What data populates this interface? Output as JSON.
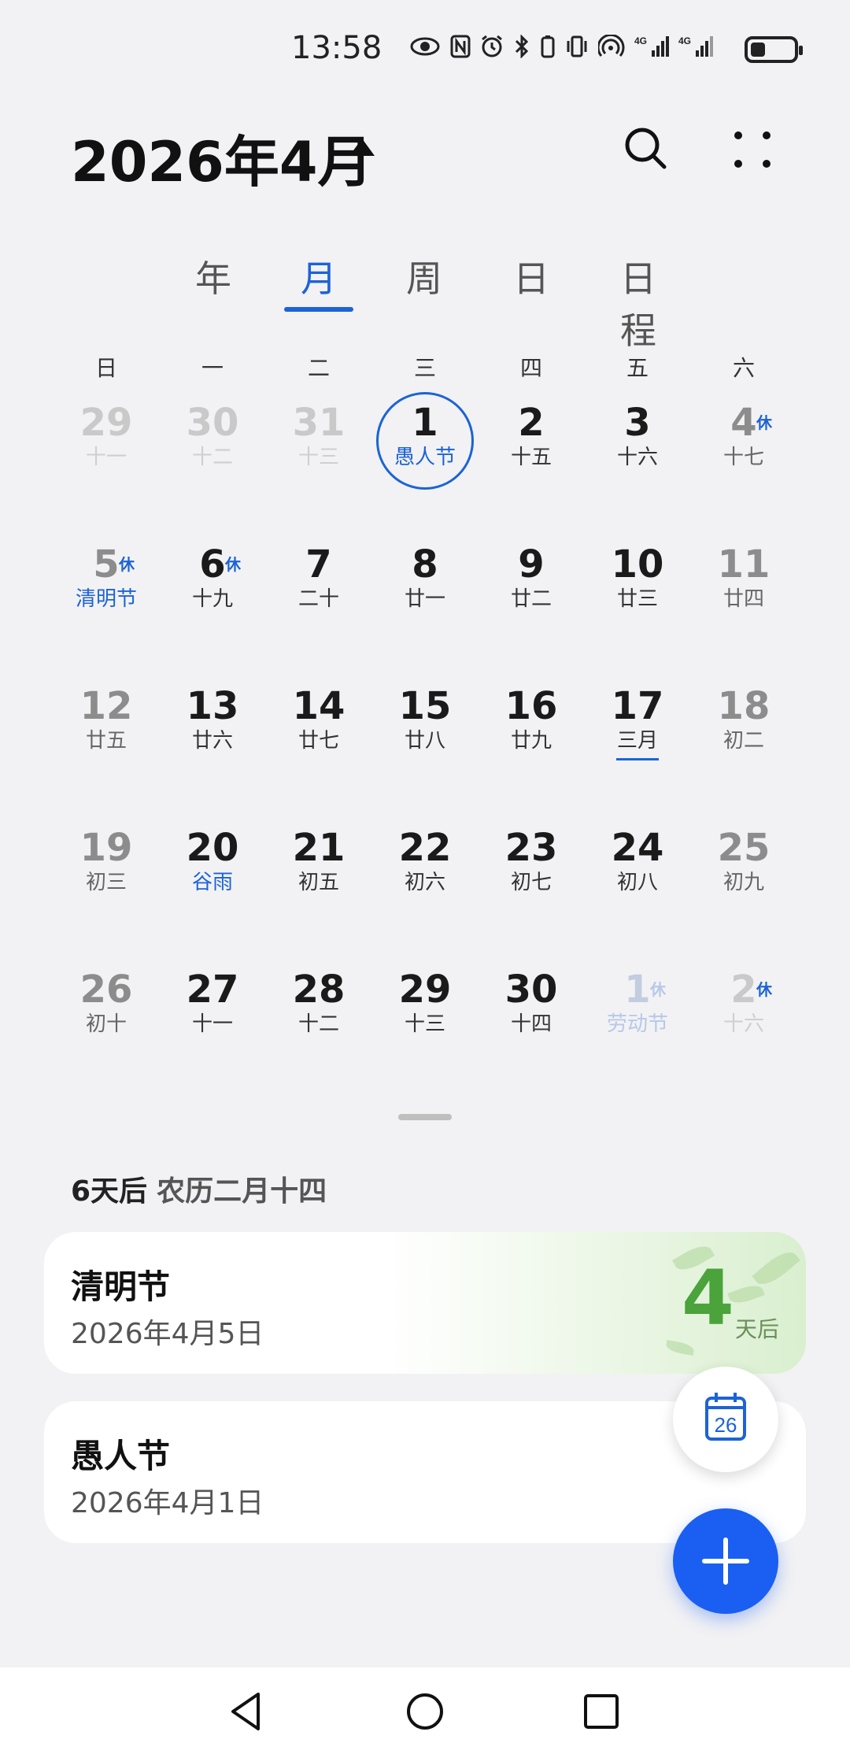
{
  "status": {
    "time": "13:58",
    "signal_label_1": "4G",
    "signal_label_2": "4G",
    "battery_level": 0.3,
    "icons": [
      "eye-icon",
      "nfc-icon",
      "alarm-icon",
      "bluetooth-icon",
      "vibrate-icon",
      "hotspot-icon",
      "signal-icon",
      "signal-icon"
    ]
  },
  "header": {
    "title": "2026年4月",
    "icons": [
      "caret-up-icon",
      "search-icon",
      "more-icon"
    ]
  },
  "tabs": [
    {
      "label": "年",
      "active": false
    },
    {
      "label": "月",
      "active": true
    },
    {
      "label": "周",
      "active": false
    },
    {
      "label": "日",
      "active": false
    },
    {
      "label": "日程",
      "active": false
    }
  ],
  "weekdays": [
    "日",
    "一",
    "二",
    "三",
    "四",
    "五",
    "六"
  ],
  "calendar": {
    "weeks": [
      [
        {
          "num": "29",
          "lunar": "十一",
          "style": "faded"
        },
        {
          "num": "30",
          "lunar": "十二",
          "style": "faded"
        },
        {
          "num": "31",
          "lunar": "十三",
          "style": "faded"
        },
        {
          "num": "1",
          "lunar": "愚人节",
          "style": "dark",
          "today": true,
          "lunar_blue": true
        },
        {
          "num": "2",
          "lunar": "十五",
          "style": "dark"
        },
        {
          "num": "3",
          "lunar": "十六",
          "style": "dark"
        },
        {
          "num": "4",
          "lunar": "十七",
          "style": "weekend",
          "rest": "休"
        }
      ],
      [
        {
          "num": "5",
          "lunar": "清明节",
          "style": "weekend",
          "rest": "休",
          "lunar_blue": true
        },
        {
          "num": "6",
          "lunar": "十九",
          "style": "dark",
          "rest": "休"
        },
        {
          "num": "7",
          "lunar": "二十",
          "style": "dark"
        },
        {
          "num": "8",
          "lunar": "廿一",
          "style": "dark"
        },
        {
          "num": "9",
          "lunar": "廿二",
          "style": "dark"
        },
        {
          "num": "10",
          "lunar": "廿三",
          "style": "dark"
        },
        {
          "num": "11",
          "lunar": "廿四",
          "style": "weekend"
        }
      ],
      [
        {
          "num": "12",
          "lunar": "廿五",
          "style": "weekend"
        },
        {
          "num": "13",
          "lunar": "廿六",
          "style": "dark"
        },
        {
          "num": "14",
          "lunar": "廿七",
          "style": "dark"
        },
        {
          "num": "15",
          "lunar": "廿八",
          "style": "dark"
        },
        {
          "num": "16",
          "lunar": "廿九",
          "style": "dark"
        },
        {
          "num": "17",
          "lunar": "三月",
          "style": "dark",
          "underline": true
        },
        {
          "num": "18",
          "lunar": "初二",
          "style": "weekend"
        }
      ],
      [
        {
          "num": "19",
          "lunar": "初三",
          "style": "weekend"
        },
        {
          "num": "20",
          "lunar": "谷雨",
          "style": "dark",
          "lunar_blue": true
        },
        {
          "num": "21",
          "lunar": "初五",
          "style": "dark"
        },
        {
          "num": "22",
          "lunar": "初六",
          "style": "dark"
        },
        {
          "num": "23",
          "lunar": "初七",
          "style": "dark"
        },
        {
          "num": "24",
          "lunar": "初八",
          "style": "dark"
        },
        {
          "num": "25",
          "lunar": "初九",
          "style": "weekend"
        }
      ],
      [
        {
          "num": "26",
          "lunar": "初十",
          "style": "weekend"
        },
        {
          "num": "27",
          "lunar": "十一",
          "style": "dark"
        },
        {
          "num": "28",
          "lunar": "十二",
          "style": "dark"
        },
        {
          "num": "29",
          "lunar": "十三",
          "style": "dark"
        },
        {
          "num": "30",
          "lunar": "十四",
          "style": "dark"
        },
        {
          "num": "1",
          "lunar": "劳动节",
          "style": "faded-blue",
          "rest": "休"
        },
        {
          "num": "2",
          "lunar": "十六",
          "style": "faded",
          "rest": "休"
        }
      ]
    ]
  },
  "upcoming": {
    "days_label": "6天后",
    "lunar_label": "农历二月十四"
  },
  "events": [
    {
      "title": "清明节",
      "date": "2026年4月5日",
      "countdown": "4",
      "countdown_unit": "天后"
    },
    {
      "title": "愚人节",
      "date": "2026年4月1日"
    }
  ],
  "fab": {
    "today_day": "26"
  },
  "colors": {
    "accent": "#1c63d6",
    "fab": "#1a5ff2",
    "countdown": "#4aa33b"
  }
}
